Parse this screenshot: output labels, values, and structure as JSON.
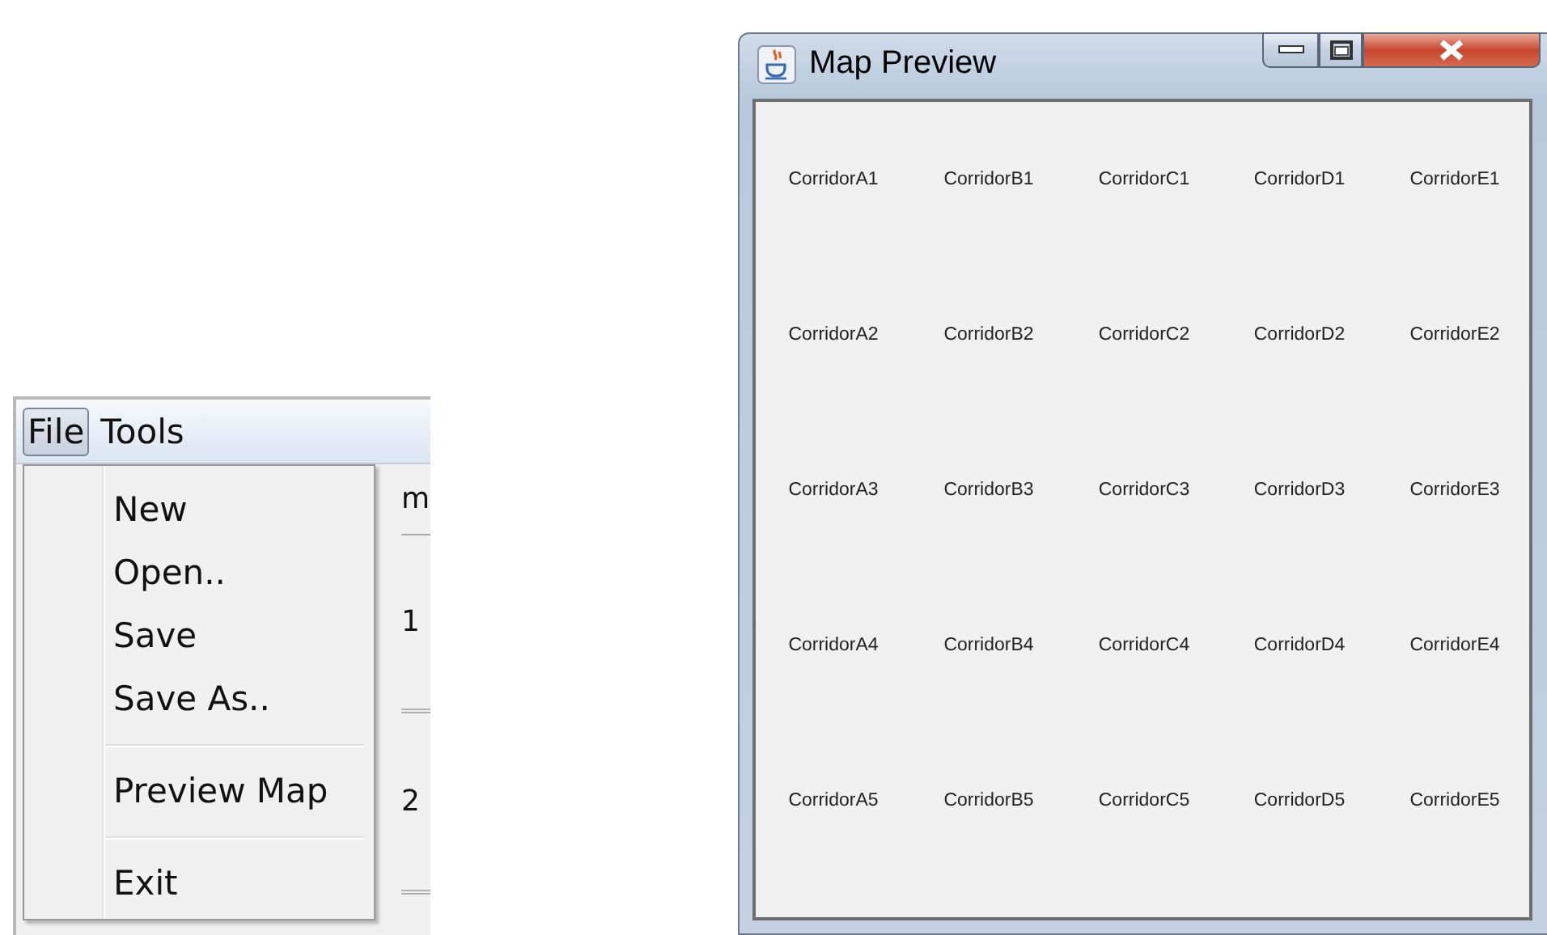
{
  "editor_window": {
    "menu_bar": [
      {
        "label": "File",
        "selected": true
      },
      {
        "label": "Tools",
        "selected": false
      }
    ],
    "file_menu": [
      {
        "kind": "item",
        "label": "New"
      },
      {
        "kind": "item",
        "label": "Open.."
      },
      {
        "kind": "item",
        "label": "Save"
      },
      {
        "kind": "item",
        "label": "Save As.."
      },
      {
        "kind": "separator"
      },
      {
        "kind": "item",
        "label": "Preview Map"
      },
      {
        "kind": "separator"
      },
      {
        "kind": "item",
        "label": "Exit"
      }
    ],
    "background_texts": [
      "m",
      "1",
      "2"
    ]
  },
  "preview_window": {
    "title": "Map Preview",
    "grid": [
      [
        "CorridorA1",
        "CorridorB1",
        "CorridorC1",
        "CorridorD1",
        "CorridorE1"
      ],
      [
        "CorridorA2",
        "CorridorB2",
        "CorridorC2",
        "CorridorD2",
        "CorridorE2"
      ],
      [
        "CorridorA3",
        "CorridorB3",
        "CorridorC3",
        "CorridorD3",
        "CorridorE3"
      ],
      [
        "CorridorA4",
        "CorridorB4",
        "CorridorC4",
        "CorridorD4",
        "CorridorE4"
      ],
      [
        "CorridorA5",
        "CorridorB5",
        "CorridorC5",
        "CorridorD5",
        "CorridorE5"
      ]
    ]
  }
}
